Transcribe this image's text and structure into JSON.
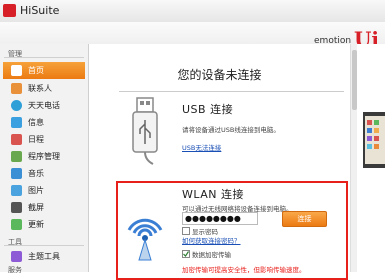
{
  "window": {
    "title": "HiSuite"
  },
  "header": {
    "brand_small": "emotion",
    "brand_mark": "Ui"
  },
  "sidebar": {
    "section_manage": "管理",
    "section_tools": "工具",
    "section_services": "服务",
    "items": [
      {
        "label": "首页",
        "icon": "home-icon",
        "color": "#3b7fd4"
      },
      {
        "label": "联系人",
        "icon": "contacts-icon",
        "color": "#e8903a"
      },
      {
        "label": "天天电话",
        "icon": "phone-icon",
        "color": "#2f9fd8"
      },
      {
        "label": "信息",
        "icon": "message-icon",
        "color": "#3aa0e0"
      },
      {
        "label": "日程",
        "icon": "calendar-icon",
        "color": "#d9534f"
      },
      {
        "label": "程序管理",
        "icon": "apps-icon",
        "color": "#6aa84f"
      },
      {
        "label": "音乐",
        "icon": "music-icon",
        "color": "#3b8fd4"
      },
      {
        "label": "图片",
        "icon": "picture-icon",
        "color": "#4aa3df"
      },
      {
        "label": "截屏",
        "icon": "screenshot-icon",
        "color": "#555555"
      },
      {
        "label": "更新",
        "icon": "update-icon",
        "color": "#5cb85c"
      },
      {
        "label": "主题工具",
        "icon": "theme-icon",
        "color": "#8e5bd6"
      }
    ]
  },
  "main": {
    "title": "您的设备未连接",
    "usb": {
      "title": "USB 连接",
      "desc": "请将设备通过USB线连接到电脑。",
      "link": "USB无法连接"
    },
    "wlan": {
      "title": "WLAN 连接",
      "desc": "可以通过无线网络将设备连接到电脑。",
      "password_value": "●●●●●●●●",
      "connect_label": "连接",
      "show_password": "显示密码",
      "forgot_link": "如何获取连接密码？",
      "encrypt_label": "数据加密传输",
      "warning": "加密传输可提高安全性，但影响传输速度。"
    }
  },
  "colors": {
    "accent": "#ec7a12",
    "highlight": "#e8201c",
    "link": "#1a4fb5"
  }
}
